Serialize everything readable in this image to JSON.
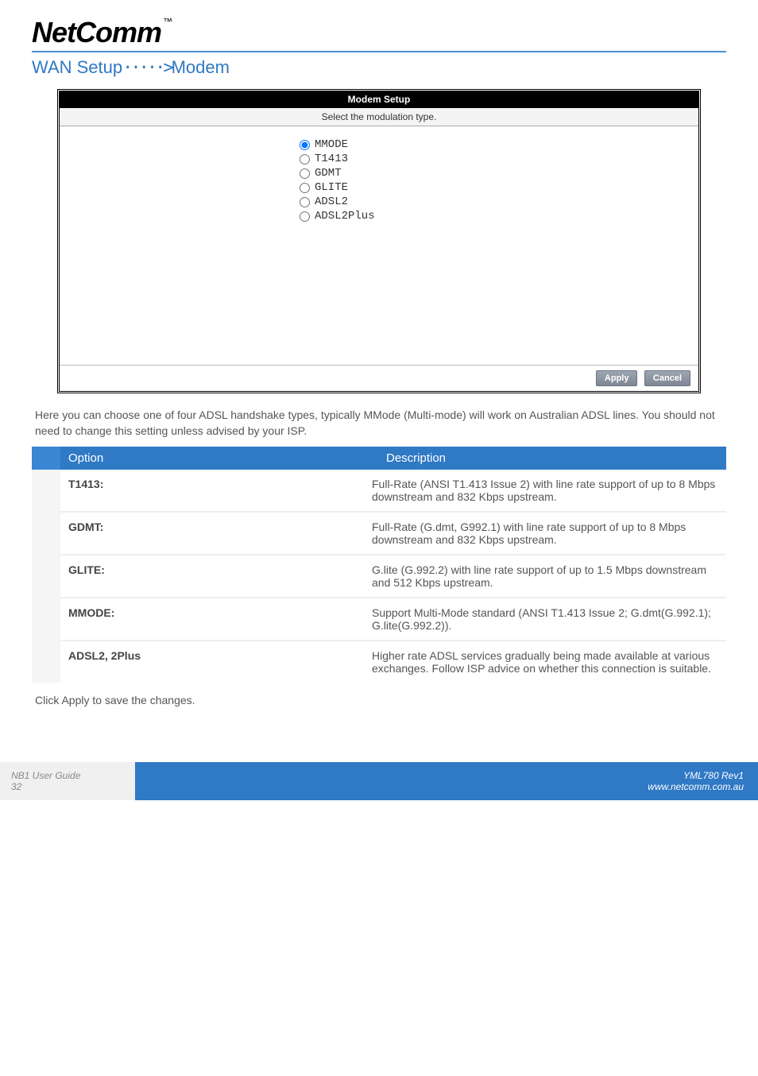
{
  "brand": {
    "name": "NetComm",
    "tm": "™"
  },
  "section_title": {
    "left": "WAN Setup",
    "arrow": "·····>",
    "right": "Modem"
  },
  "modem_box": {
    "header": "Modem Setup",
    "subheader": "Select the modulation type.",
    "options": [
      {
        "label": "MMODE",
        "checked": true
      },
      {
        "label": "T1413",
        "checked": false
      },
      {
        "label": "GDMT",
        "checked": false
      },
      {
        "label": "GLITE",
        "checked": false
      },
      {
        "label": "ADSL2",
        "checked": false
      },
      {
        "label": "ADSL2Plus",
        "checked": false
      }
    ],
    "apply": "Apply",
    "cancel": "Cancel"
  },
  "body_text": "Here you can choose one of four ADSL handshake types, typically MMode (Multi-mode) will work on Australian ADSL lines. You should not need to change this setting unless advised by your ISP.",
  "table_header": {
    "col1": "Option",
    "col2": "Description"
  },
  "rows": [
    {
      "label": "T1413:",
      "desc": "Full-Rate (ANSI T1.413 Issue 2) with line rate support of up to 8 Mbps downstream and 832 Kbps upstream."
    },
    {
      "label": "GDMT:",
      "desc": "Full-Rate (G.dmt, G992.1) with line rate support of up to 8 Mbps downstream and 832 Kbps upstream."
    },
    {
      "label": "GLITE:",
      "desc": "G.lite (G.992.2) with line rate support of up to 1.5 Mbps downstream and 512 Kbps upstream."
    },
    {
      "label": "MMODE:",
      "desc": "Support Multi-Mode standard (ANSI T1.413 Issue 2; G.dmt(G.992.1); G.lite(G.992.2))."
    },
    {
      "label": "ADSL2, 2Plus",
      "desc": "Higher rate ADSL services gradually being made available at various exchanges. Follow ISP advice on whether this connection is suitable."
    }
  ],
  "after_table": "Click Apply to save the changes.",
  "footer": {
    "guide": "NB1 User Guide",
    "page": "32",
    "rev": "YML780 Rev1",
    "url": "www.netcomm.com.au"
  }
}
